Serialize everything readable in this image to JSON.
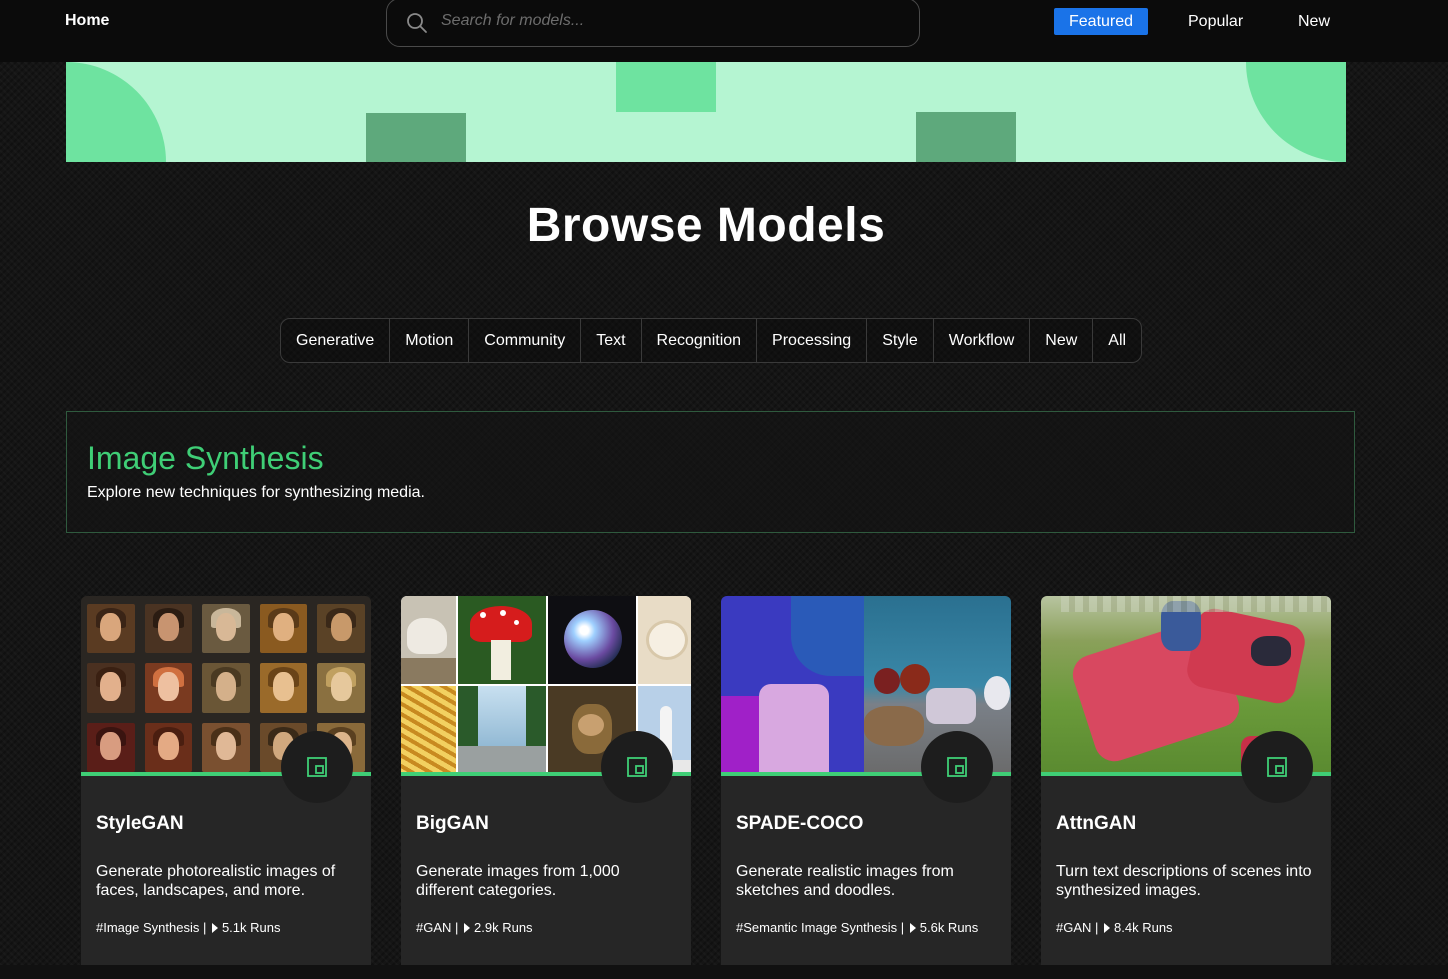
{
  "nav": {
    "home_label": "Home",
    "search_placeholder": "Search for models...",
    "sort_tabs": [
      {
        "label": "Featured",
        "active": true
      },
      {
        "label": "Popular",
        "active": false
      },
      {
        "label": "New",
        "active": false
      }
    ]
  },
  "page": {
    "title": "Browse Models"
  },
  "categories": [
    "Generative",
    "Motion",
    "Community",
    "Text",
    "Recognition",
    "Processing",
    "Style",
    "Workflow",
    "New",
    "All"
  ],
  "section": {
    "title": "Image Synthesis",
    "subtitle": "Explore new techniques for synthesizing media."
  },
  "cards": [
    {
      "title": "StyleGAN",
      "description": "Generate photorealistic images of faces, landscapes, and more.",
      "tag": "#Image Synthesis",
      "runs": "5.1k Runs",
      "badge_icon": "expand-icon"
    },
    {
      "title": "BigGAN",
      "description": "Generate images from 1,000 different categories.",
      "tag": "#GAN",
      "runs": "2.9k Runs",
      "badge_icon": "expand-icon"
    },
    {
      "title": "SPADE-COCO",
      "description": "Generate realistic images from sketches and doodles.",
      "tag": "#Semantic Image Synthesis",
      "runs": "5.6k Runs",
      "badge_icon": "expand-icon"
    },
    {
      "title": "AttnGAN",
      "description": "Turn text descriptions of scenes into synthesized images.",
      "tag": "#GAN",
      "runs": "8.4k Runs",
      "badge_icon": "expand-icon"
    }
  ],
  "colors": {
    "accent_green": "#3fce76",
    "banner_bg": "#b5f5d2",
    "active_tab": "#1a73e8",
    "card_bg": "#262626"
  }
}
